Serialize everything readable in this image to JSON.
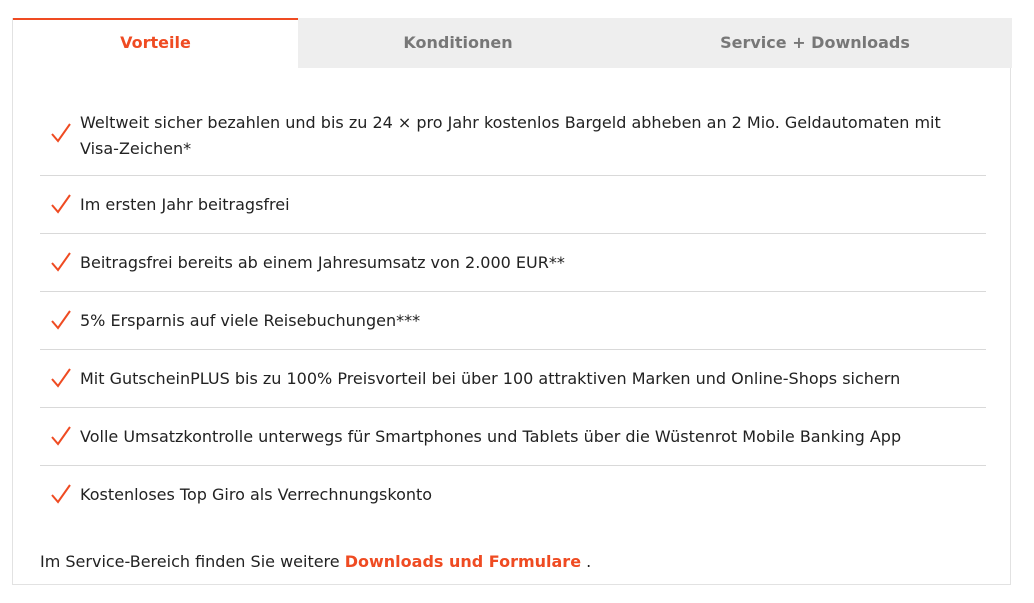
{
  "tabs": [
    {
      "label": "Vorteile",
      "active": true
    },
    {
      "label": "Konditionen",
      "active": false
    },
    {
      "label": "Service + Downloads",
      "active": false
    }
  ],
  "benefits": [
    "Weltweit sicher bezahlen und bis zu 24 × pro Jahr kostenlos Bargeld abheben an 2 Mio. Geldautomaten mit Visa-Zeichen*",
    "Im ersten Jahr beitragsfrei",
    "Beitragsfrei bereits ab einem Jahresumsatz von 2.000 EUR**",
    "5% Ersparnis auf viele Reisebuchungen***",
    "Mit GutscheinPLUS bis zu 100% Preisvorteil bei über 100 attraktiven Marken und Online-Shops sichern",
    "Volle Umsatzkontrolle unterwegs für Smartphones und Tablets über die Wüstenrot Mobile Banking App",
    "Kostenloses Top Giro als Verrechnungskonto"
  ],
  "footer": {
    "prefix": "Im Service-Bereich finden Sie weitere ",
    "link": "Downloads und Formulare",
    "suffix": " ."
  },
  "colors": {
    "accent": "#ef4b22",
    "tab_inactive_bg": "#eeeeee",
    "divider": "#d9d9d9"
  },
  "icons": {
    "check": "checkmark-icon"
  }
}
